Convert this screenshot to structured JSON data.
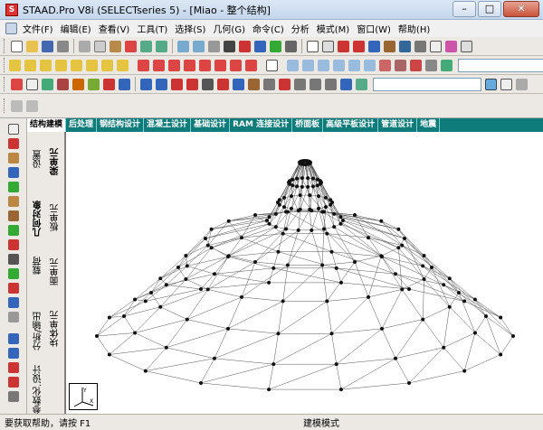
{
  "window": {
    "title": "STAAD.Pro V8i (SELECTseries 5) - [Miao - 整个结构]",
    "min": "–",
    "max": "□",
    "close": "✕"
  },
  "menu": [
    "文件(F)",
    "编辑(E)",
    "查看(V)",
    "工具(T)",
    "选择(S)",
    "几何(G)",
    "命令(C)",
    "分析",
    "模式(M)",
    "窗口(W)",
    "帮助(H)"
  ],
  "tabs": [
    "结构建模",
    "后处理",
    "钢结构设计",
    "混凝土设计",
    "基础设计",
    "RAM 连接设计",
    "桥面板",
    "高级平板设计",
    "管道设计",
    "地震"
  ],
  "side_tabs": [
    "设置",
    "几何对象",
    "梁单元",
    "板单元",
    "载荷",
    "面单元",
    "分析/输出",
    "块体单元",
    "设计",
    "参数化..."
  ],
  "status": {
    "help": "要获取帮助，请按 F1",
    "mode": "建模模式"
  },
  "colors": {
    "tab_bar": "#0f7c7c",
    "accent": "#d33"
  }
}
